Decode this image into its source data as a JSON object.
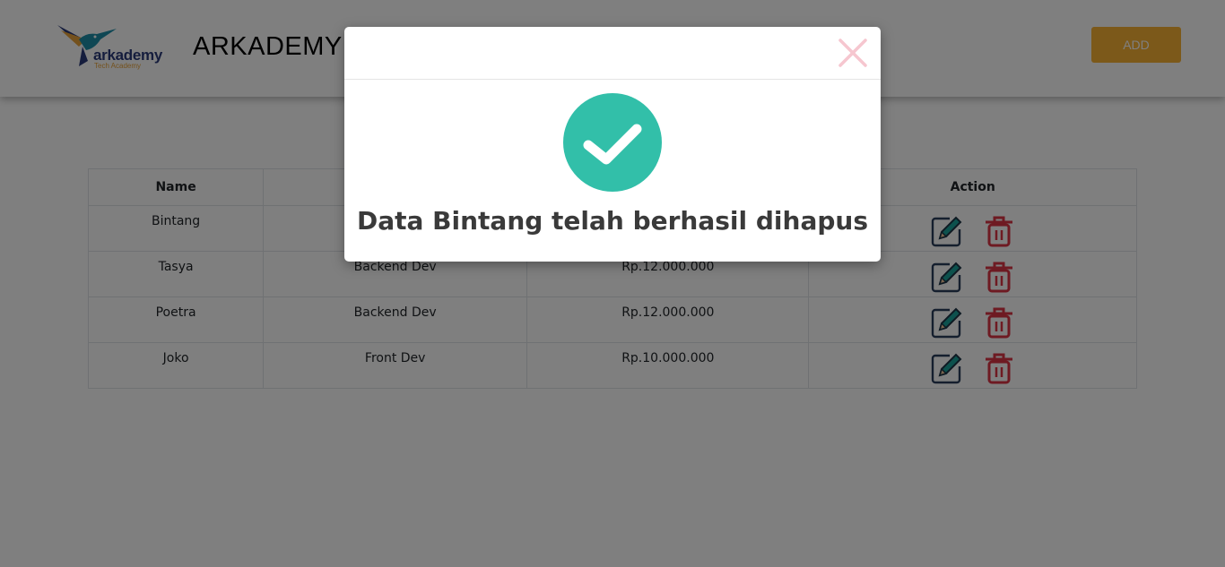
{
  "header": {
    "logo_text": "arkademy",
    "logo_subtext": "Tech Academy",
    "brand": "ARKADEMY",
    "add_button": "ADD"
  },
  "table": {
    "columns": [
      "Name",
      "",
      "",
      "Action"
    ],
    "rows": [
      {
        "name": "Bintang",
        "position": "",
        "salary": ""
      },
      {
        "name": "Tasya",
        "position": "Backend Dev",
        "salary": "Rp.12.000.000"
      },
      {
        "name": "Poetra",
        "position": "Backend Dev",
        "salary": "Rp.12.000.000"
      },
      {
        "name": "Joko",
        "position": "Front Dev",
        "salary": "Rp.10.000.000"
      }
    ],
    "action_icons": [
      "edit-icon",
      "trash-icon"
    ]
  },
  "modal": {
    "message": "Data Bintang telah berhasil dihapus",
    "icon": "check-circle-icon",
    "close_icon": "close-icon"
  },
  "colors": {
    "add_button": "#f8b234",
    "success": "#32bfa9",
    "delete": "#dc3545",
    "edit_pen": "#1aa39a",
    "close_x": "#f6c6cf"
  }
}
